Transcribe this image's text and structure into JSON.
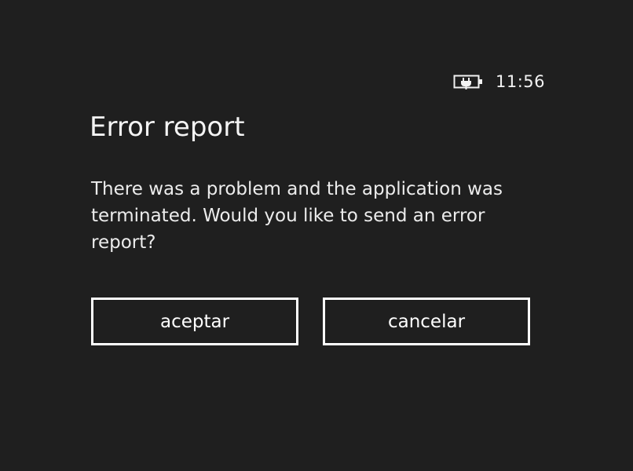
{
  "status_bar": {
    "battery_icon": "battery-charging-icon",
    "time": "11:56"
  },
  "dialog": {
    "title": "Error report",
    "message": "There was a problem and the application was terminated. Would you like to send an error report?",
    "buttons": {
      "accept_label": "aceptar",
      "cancel_label": "cancelar"
    }
  },
  "colors": {
    "background": "#1f1f1f",
    "foreground": "#ffffff"
  }
}
